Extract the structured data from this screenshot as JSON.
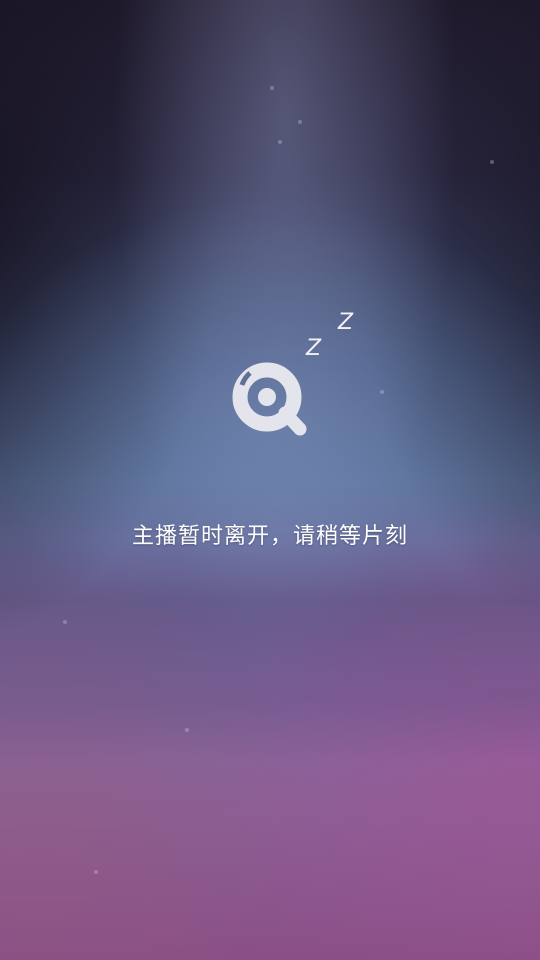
{
  "logo": {
    "icon": "sleeping-q-logo-icon",
    "zz_small": "Z",
    "zz_large": "Z"
  },
  "message": {
    "text": "主播暂时离开，请稍等片刻"
  }
}
